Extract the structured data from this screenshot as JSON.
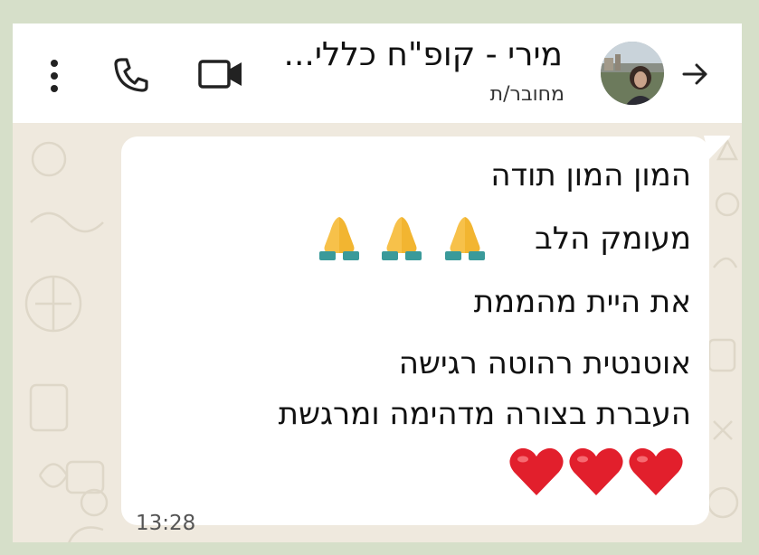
{
  "header": {
    "contact_name": "מירי - קופ\"ח כללי...",
    "status": "מחובר/ת",
    "icons": [
      "back-arrow-icon",
      "avatar",
      "video-icon",
      "phone-icon",
      "more-vert-icon"
    ]
  },
  "message": {
    "lines": [
      "המון המון תודה",
      "מעומק הלב",
      "את היית מהממת",
      "אוטנטית רהוטה רגישה",
      "העברת בצורה מדהימה ומרגשת"
    ],
    "emojis": {
      "line2": [
        "folded-hands",
        "folded-hands",
        "folded-hands"
      ],
      "line6": [
        "red-heart",
        "red-heart",
        "red-heart"
      ]
    },
    "time": "13:28"
  },
  "colors": {
    "background_frame": "#d6dfc9",
    "wallpaper": "#efe9de",
    "bubble": "#ffffff"
  }
}
